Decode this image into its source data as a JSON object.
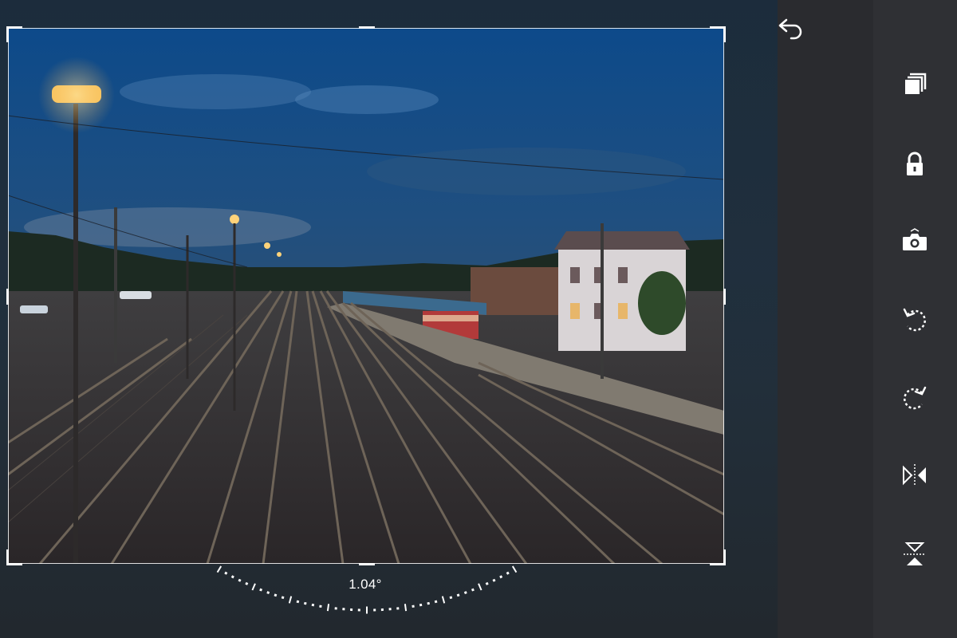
{
  "editor": {
    "angle_readout": "1.04°"
  },
  "toolbar": {
    "tools": [
      {
        "name": "undo",
        "icon": "undo-icon"
      },
      {
        "name": "aspect-ratio",
        "icon": "aspect-ratio-icon"
      },
      {
        "name": "lock",
        "icon": "lock-icon"
      },
      {
        "name": "auto-straighten",
        "icon": "auto-straighten-icon"
      },
      {
        "name": "rotate-left",
        "icon": "rotate-left-icon"
      },
      {
        "name": "rotate-right",
        "icon": "rotate-right-icon"
      },
      {
        "name": "flip-horizontal",
        "icon": "flip-horizontal-icon"
      },
      {
        "name": "flip-vertical",
        "icon": "flip-vertical-icon"
      }
    ]
  },
  "colors": {
    "icon": "#ffffff",
    "toolbar_bg": "#2f3034",
    "canvas_bg": "#1a2733"
  }
}
